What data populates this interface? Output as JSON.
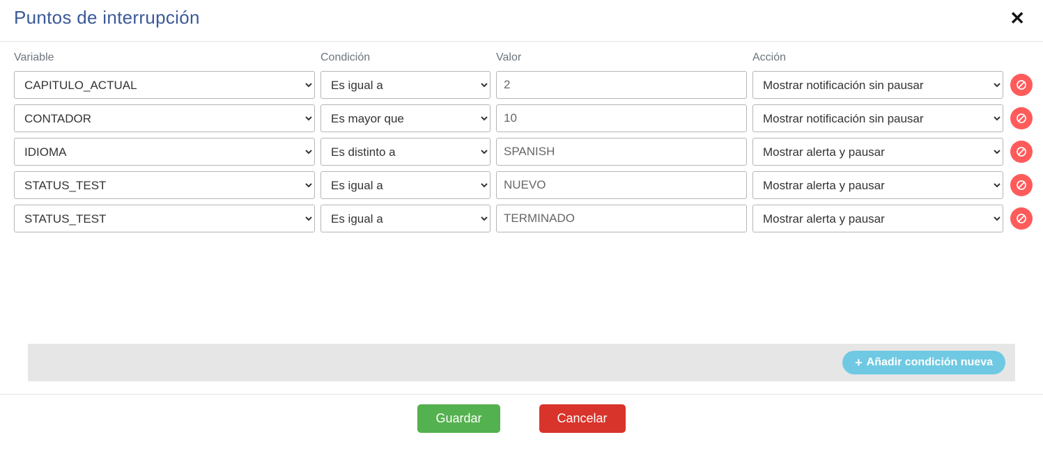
{
  "header": {
    "title": "Puntos de interrupción"
  },
  "columns": {
    "variable": "Variable",
    "condition": "Condición",
    "value": "Valor",
    "action": "Acción"
  },
  "rows": [
    {
      "variable": "CAPITULO_ACTUAL",
      "condition": "Es igual a",
      "value": "2",
      "action": "Mostrar notificación sin pausar"
    },
    {
      "variable": "CONTADOR",
      "condition": "Es mayor que",
      "value": "10",
      "action": "Mostrar notificación sin pausar"
    },
    {
      "variable": "IDIOMA",
      "condition": "Es distinto a",
      "value": "SPANISH",
      "action": "Mostrar alerta y pausar"
    },
    {
      "variable": "STATUS_TEST",
      "condition": "Es igual a",
      "value": "NUEVO",
      "action": "Mostrar alerta y pausar"
    },
    {
      "variable": "STATUS_TEST",
      "condition": "Es igual a",
      "value": "TERMINADO",
      "action": "Mostrar alerta y pausar"
    }
  ],
  "footer": {
    "add_label": "Añadir condición nueva",
    "save_label": "Guardar",
    "cancel_label": "Cancelar"
  }
}
